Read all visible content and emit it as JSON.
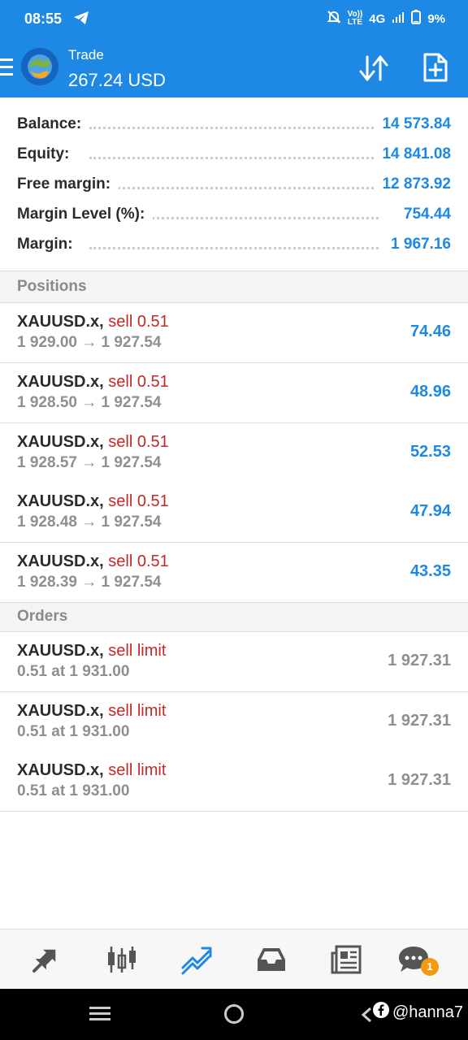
{
  "status": {
    "time": "08:55",
    "network_top": "Vo))",
    "network_bottom": "LTE",
    "network_type": "4G",
    "battery": "9%"
  },
  "appbar": {
    "title": "Trade",
    "balance": "267.24 USD"
  },
  "summary": [
    {
      "label": "Balance:",
      "value": "14 573.84"
    },
    {
      "label": "Equity:",
      "value": "14 841.08"
    },
    {
      "label": "Free margin:",
      "value": "12 873.92"
    },
    {
      "label": "Margin Level (%):",
      "value": "754.44"
    },
    {
      "label": "Margin:",
      "value": "1 967.16"
    }
  ],
  "positions_header": "Positions",
  "positions": [
    {
      "symbol": "XAUUSD.x,",
      "type": "sell 0.51",
      "prices": "1 929.00 → 1 927.54",
      "profit": "74.46"
    },
    {
      "symbol": "XAUUSD.x,",
      "type": "sell 0.51",
      "prices": "1 928.50 → 1 927.54",
      "profit": "48.96"
    },
    {
      "symbol": "XAUUSD.x,",
      "type": "sell 0.51",
      "prices": "1 928.57 → 1 927.54",
      "profit": "52.53"
    },
    {
      "symbol": "XAUUSD.x,",
      "type": "sell 0.51",
      "prices": "1 928.48 → 1 927.54",
      "profit": "47.94"
    },
    {
      "symbol": "XAUUSD.x,",
      "type": "sell 0.51",
      "prices": "1 928.39 → 1 927.54",
      "profit": "43.35"
    }
  ],
  "orders_header": "Orders",
  "orders": [
    {
      "symbol": "XAUUSD.x,",
      "type": "sell limit",
      "detail": "0.51 at 1 931.00",
      "price": "1 927.31"
    },
    {
      "symbol": "XAUUSD.x,",
      "type": "sell limit",
      "detail": "0.51 at 1 931.00",
      "price": "1 927.31"
    },
    {
      "symbol": "XAUUSD.x,",
      "type": "sell limit",
      "detail": "0.51 at 1 931.00",
      "price": "1 927.31"
    }
  ],
  "bottom_nav": {
    "items": [
      "quotes-icon",
      "chart-icon",
      "trade-icon",
      "history-icon",
      "news-icon",
      "chat-icon"
    ],
    "active": "trade-icon",
    "chat_badge": "1"
  },
  "watermark": "@hanna7",
  "colors": {
    "accent": "#1e88e5",
    "sell": "#c62828",
    "muted": "#8f8f8f",
    "badge": "#f39c12"
  }
}
